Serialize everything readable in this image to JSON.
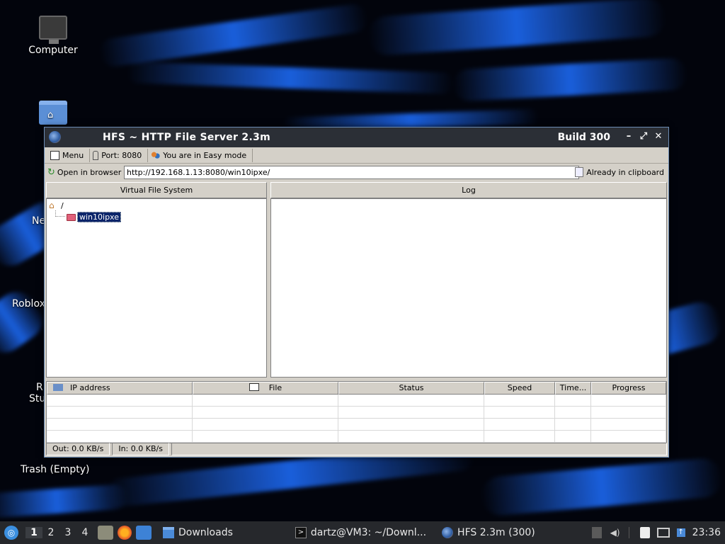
{
  "desktop": {
    "icons": [
      {
        "label": "Computer"
      },
      {
        "label": "Ne"
      },
      {
        "label": "Roblox"
      },
      {
        "label": "R"
      },
      {
        "label": "Stu"
      },
      {
        "label": "Trash (Empty)"
      }
    ]
  },
  "window": {
    "title": "HFS ~ HTTP File Server 2.3m",
    "build": "Build 300",
    "controls": {
      "minimize": "–",
      "maximize": "⤢",
      "close": "✕"
    }
  },
  "toolbar": {
    "menu": "Menu",
    "port": "Port: 8080",
    "mode": "You are in Easy mode"
  },
  "urlbar": {
    "open_label": "Open in browser",
    "url": "http://192.168.1.13:8080/win10ipxe/",
    "clipboard_label": "Already in clipboard"
  },
  "vfs": {
    "header": "Virtual File System",
    "root": "/",
    "items": [
      "win10ipxe"
    ]
  },
  "log": {
    "header": "Log"
  },
  "connections": {
    "columns": [
      "IP address",
      "File",
      "Status",
      "Speed",
      "Time...",
      "Progress"
    ]
  },
  "statusbar": {
    "out": "Out: 0.0 KB/s",
    "in": "In: 0.0 KB/s"
  },
  "taskbar": {
    "workspaces": [
      "1",
      "2",
      "3",
      "4"
    ],
    "active_workspace": "1",
    "tasks": [
      {
        "label": "Downloads"
      },
      {
        "label": "dartz@VM3: ~/Downl..."
      },
      {
        "label": "HFS 2.3m (300)"
      }
    ],
    "clock": "23:36"
  },
  "colors": {
    "taskbar_bg": "#26282c",
    "titlebar_bg": "#2b2f36",
    "window_bg": "#d4d0c8",
    "selection": "#0a246a",
    "wallpaper_accent": "#1e6eff"
  }
}
